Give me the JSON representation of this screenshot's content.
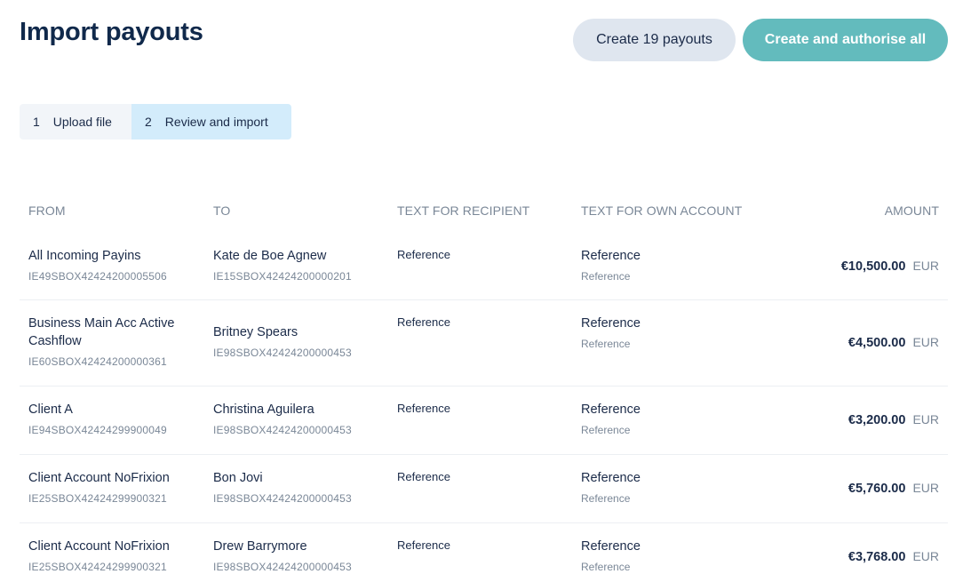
{
  "page": {
    "title": "Import payouts"
  },
  "actions": {
    "create_label": "Create 19 payouts",
    "authorise_label": "Create and authorise all"
  },
  "steps": [
    {
      "number": "1",
      "label": "Upload file"
    },
    {
      "number": "2",
      "label": "Review and import"
    }
  ],
  "table": {
    "headers": {
      "from": "FROM",
      "to": "TO",
      "recipient_text": "TEXT FOR RECIPIENT",
      "own_text": "TEXT FOR OWN ACCOUNT",
      "amount": "AMOUNT"
    },
    "rows": [
      {
        "from_name": "All Incoming Payins",
        "from_iban": "IE49SBOX42424200005506",
        "to_name": "Kate de Boe Agnew",
        "to_iban": "IE15SBOX42424200000201",
        "recipient_text": "Reference",
        "own_main": "Reference",
        "own_sub": "Reference",
        "amount": "€10,500.00",
        "currency": "EUR"
      },
      {
        "from_name": "Business Main Acc Active Cashflow",
        "from_iban": "IE60SBOX42424200000361",
        "to_name": "Britney Spears",
        "to_iban": "IE98SBOX42424200000453",
        "recipient_text": "Reference",
        "own_main": "Reference",
        "own_sub": "Reference",
        "amount": "€4,500.00",
        "currency": "EUR"
      },
      {
        "from_name": "Client A",
        "from_iban": "IE94SBOX42424299900049",
        "to_name": "Christina Aguilera",
        "to_iban": "IE98SBOX42424200000453",
        "recipient_text": "Reference",
        "own_main": "Reference",
        "own_sub": "Reference",
        "amount": "€3,200.00",
        "currency": "EUR"
      },
      {
        "from_name": "Client Account NoFrixion",
        "from_iban": "IE25SBOX42424299900321",
        "to_name": "Bon Jovi",
        "to_iban": "IE98SBOX42424200000453",
        "recipient_text": "Reference",
        "own_main": "Reference",
        "own_sub": "Reference",
        "amount": "€5,760.00",
        "currency": "EUR"
      },
      {
        "from_name": "Client Account NoFrixion",
        "from_iban": "IE25SBOX42424299900321",
        "to_name": "Drew Barrymore",
        "to_iban": "IE98SBOX42424200000453",
        "recipient_text": "Reference",
        "own_main": "Reference",
        "own_sub": "Reference",
        "amount": "€3,768.00",
        "currency": "EUR"
      }
    ]
  }
}
